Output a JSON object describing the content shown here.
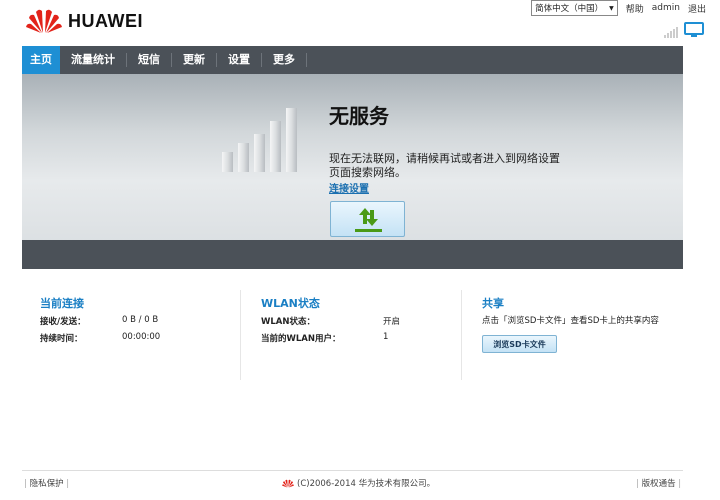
{
  "brand": {
    "name": "HUAWEI"
  },
  "header": {
    "language": "简体中文（中国）",
    "help": "帮助",
    "user": "admin",
    "logout": "退出"
  },
  "nav": {
    "items": [
      "主页",
      "流量统计",
      "短信",
      "更新",
      "设置",
      "更多"
    ],
    "active_index": 0
  },
  "banner": {
    "title": "无服务",
    "message": "现在无法联网，请稍候再试或者进入到网络设置页面搜索网络。",
    "link": "连接设置"
  },
  "connection": {
    "title": "当前连接",
    "rx_tx_label": "接收/发送：",
    "rx_tx_value": "0 B / 0 B",
    "duration_label": "持续时间：",
    "duration_value": "00:00:00"
  },
  "wlan": {
    "title": "WLAN状态",
    "status_label": "WLAN状态：",
    "status_value": "开启",
    "users_label": "当前的WLAN用户：",
    "users_value": "1"
  },
  "share": {
    "title": "共享",
    "desc": "点击「浏览SD卡文件」查看SD卡上的共享内容",
    "button": "浏览SD卡文件"
  },
  "footer": {
    "privacy": "隐私保护",
    "copyright": "(C)2006-2014 华为技术有限公司。",
    "copyright_notice": "版权通告"
  },
  "colors": {
    "accent": "#1e8fd4",
    "nav_bg": "#4b5158",
    "logo_red": "#e2231a",
    "link": "#1a6fb0"
  },
  "icons": {
    "signal": "signal-strength-icon",
    "monitor": "pc-monitor-icon",
    "connect": "updown-arrows-icon"
  }
}
